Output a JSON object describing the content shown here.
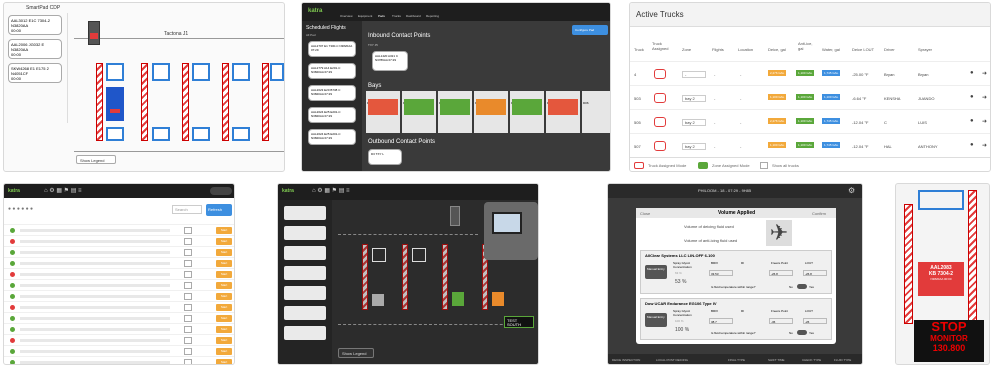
{
  "tile1": {
    "header": "SmartPad CDP",
    "pad_label": "Tactona J1",
    "show_legend": "Show Legend",
    "flights": [
      {
        "line1": "AAL3012 E1C 7304-2",
        "line2": "N3820AA",
        "line3": "00:00"
      },
      {
        "line1": "AAL2006 JG032 E",
        "line2": "N3820AA",
        "line3": "00:00"
      },
      {
        "line1": "SKW4268 E1 E175 2",
        "line2": "N4051CF",
        "line3": "00:00"
      }
    ]
  },
  "tile2": {
    "brand": "katra",
    "nav": [
      "Overview",
      "Equipment",
      "Pads",
      "Trucks",
      "Dashboard",
      "Reporting"
    ],
    "sidebar_title": "Scheduled Flights",
    "sidebar_sub": "All Pad",
    "flights": [
      "AAL2707 E1 7300-C N3820AA 07:29",
      "AAL2779 A14 E201-C N3820AA 07:29",
      "AAL2023 E20 B738 C N3820AA 07:29",
      "AAL2024 E25 E201-C N3820AA 07:29",
      "AAL2024 E25 E201-C N3820AA 07:29"
    ],
    "configure_btn": "Configure Pad",
    "inbound_title": "Inbound Contact Points",
    "inbound_sub": "TXY J5",
    "inbound_card": "AAL1420 A321 C N3789AA 07:29",
    "bays_title": "Bays",
    "bay_labels": [
      "D01",
      "D01",
      "D02",
      "D03",
      "D04",
      "D05",
      "D06"
    ],
    "outbound_title": "Outbound Contact Points",
    "outbound_sub": "D3 TXY L"
  },
  "tile3": {
    "title": "Active Trucks",
    "columns": [
      "Truck",
      "Truck Assigned",
      "Zone",
      "Flights",
      "Location",
      "Deice, gal",
      "Anti-ice, gal",
      "Water, gal",
      "Deice LOUT",
      "Driver",
      "Sprayer"
    ],
    "rows": [
      {
        "truck": "4",
        "zone": "-",
        "flights": "-",
        "location": "-",
        "deice": "2,276 GAL",
        "anti": "1,100 GAL",
        "water": "1,745 GAL",
        "lout": "-25.00 °F",
        "driver": "Bryan",
        "sprayer": "Bryan"
      },
      {
        "truck": "503",
        "zone": "bay 2",
        "flights": "-",
        "location": "-",
        "deice": "1,100 GAL",
        "anti": "1,100 GAL",
        "water": "1,100 GAL",
        "lout": "-6.64 °F",
        "driver": "KENSHA",
        "sprayer": "JUANDO"
      },
      {
        "truck": "505",
        "zone": "bay 2",
        "flights": "-",
        "location": "-",
        "deice": "2,276 GAL",
        "anti": "1,100 GAL",
        "water": "1,745 GAL",
        "lout": "-12.04 °F",
        "driver": "C",
        "sprayer": "LUIS"
      },
      {
        "truck": "507",
        "zone": "bay 2",
        "flights": "-",
        "location": "-",
        "deice": "1,100 GAL",
        "anti": "1,100 GAL",
        "water": "1,745 GAL",
        "lout": "-12.04 °F",
        "driver": "HAL",
        "sprayer": "ANTHONY"
      }
    ],
    "legend": [
      "Truck Assigned Mode",
      "Zone Assigned Mode",
      "Show all trucks"
    ]
  },
  "tile4": {
    "brand": "katra",
    "search": "Search",
    "refresh_btn": "Refresh",
    "action_btn": "Start",
    "row_count": 13
  },
  "tile5": {
    "brand": "katra",
    "show_legend": "Show Legend",
    "test_label": "TEST SOUTH"
  },
  "tile6": {
    "top_title": "PHILOOM - 18 - 07:29 - 9H85",
    "modal_title": "Volume Applied",
    "close": "Close",
    "confirm": "Confirm",
    "q1": "Volume of deicing fluid used",
    "q2": "Volume of anti-icing fluid used",
    "section1": "AllClear Systems LLC LIN-OFF 6-100",
    "section2": "Dow UCAR Endurance EG106 Type IV",
    "manual_entry": "Manual Entry",
    "col_spray": "Spray Glycol Concentration",
    "col_brix": "BRIX",
    "col_ri": "RI",
    "col_freeze": "Freeze Point",
    "col_lout": "LOUT",
    "s1_vals": [
      "63 %",
      "33.53",
      "",
      "-26.8",
      "-26.8"
    ],
    "s1_pct": "53 %",
    "s2_vals": [
      "100 %",
      "38.7",
      "",
      "-36",
      "-26"
    ],
    "s2_pct": "100 %",
    "fluid_q": "Is fluid temperature within range?",
    "no": "No",
    "yes": "Yes",
    "footer": [
      "DEICE INSPECTION",
      "LOCAL POST DEICING",
      "FINAL TYPE",
      "SHIFT TIME",
      "CHECK TYPE",
      "FLUID TYPE"
    ]
  },
  "tile7": {
    "flight_line1": "AAL2083",
    "flight_line2": "KB 7304-2",
    "flight_line3": "N3820AA 00:00",
    "stop": "STOP",
    "monitor": "MONITOR",
    "value": "130.800"
  }
}
